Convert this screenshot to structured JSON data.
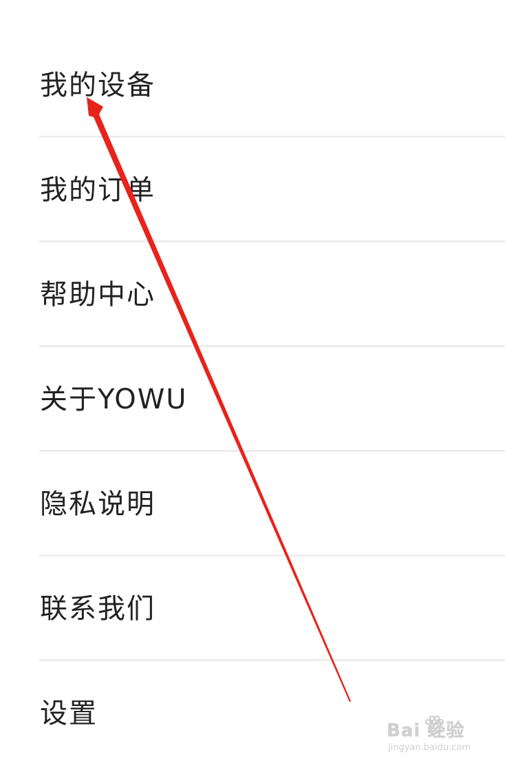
{
  "menu": {
    "items": [
      {
        "label": "我的设备"
      },
      {
        "label": "我的订单"
      },
      {
        "label": "帮助中心"
      },
      {
        "label": "关于YOWU"
      },
      {
        "label": "隐私说明"
      },
      {
        "label": "联系我们"
      },
      {
        "label": "设置"
      }
    ]
  },
  "annotation": {
    "arrow_color": "#e8231b"
  },
  "watermark": {
    "main": "Bai 经验",
    "sub": "jingyan.baidu.com"
  }
}
